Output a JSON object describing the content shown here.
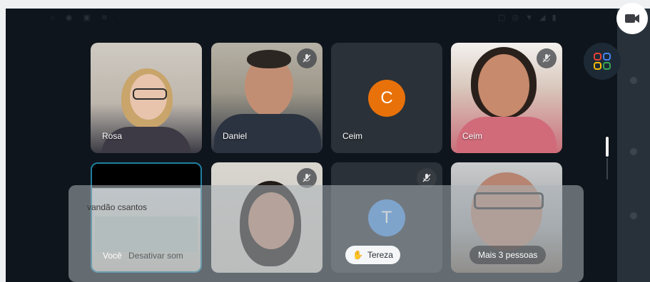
{
  "tiles": [
    {
      "name": "Rosa",
      "muted": false
    },
    {
      "name": "Daniel",
      "muted": true
    },
    {
      "name": "Ceim",
      "muted": false,
      "avatar_letter": "C",
      "avatar_color": "#e8710a"
    },
    {
      "name": "Ceim",
      "muted": true
    },
    {
      "name": "Você",
      "muted": true,
      "banner": "vandão csantos"
    },
    {
      "name": "",
      "muted": true
    },
    {
      "name": "Tereza",
      "muted": true,
      "avatar_letter": "T",
      "avatar_color": "#4a90e2"
    },
    {
      "name": "Mais 3 pessoas",
      "muted": false
    }
  ],
  "you_secondary": "Desativar som",
  "tereza_chip": "Tereza",
  "more_chip": "Mais 3 pessoas",
  "icons": {
    "camera": "camera-icon",
    "apps": "apps-icon",
    "mic_off": "mic-off-icon",
    "hand": "hand-icon"
  },
  "colors": {
    "screen_bg": "#0f151c",
    "accent_border": "#1f7fa0"
  }
}
